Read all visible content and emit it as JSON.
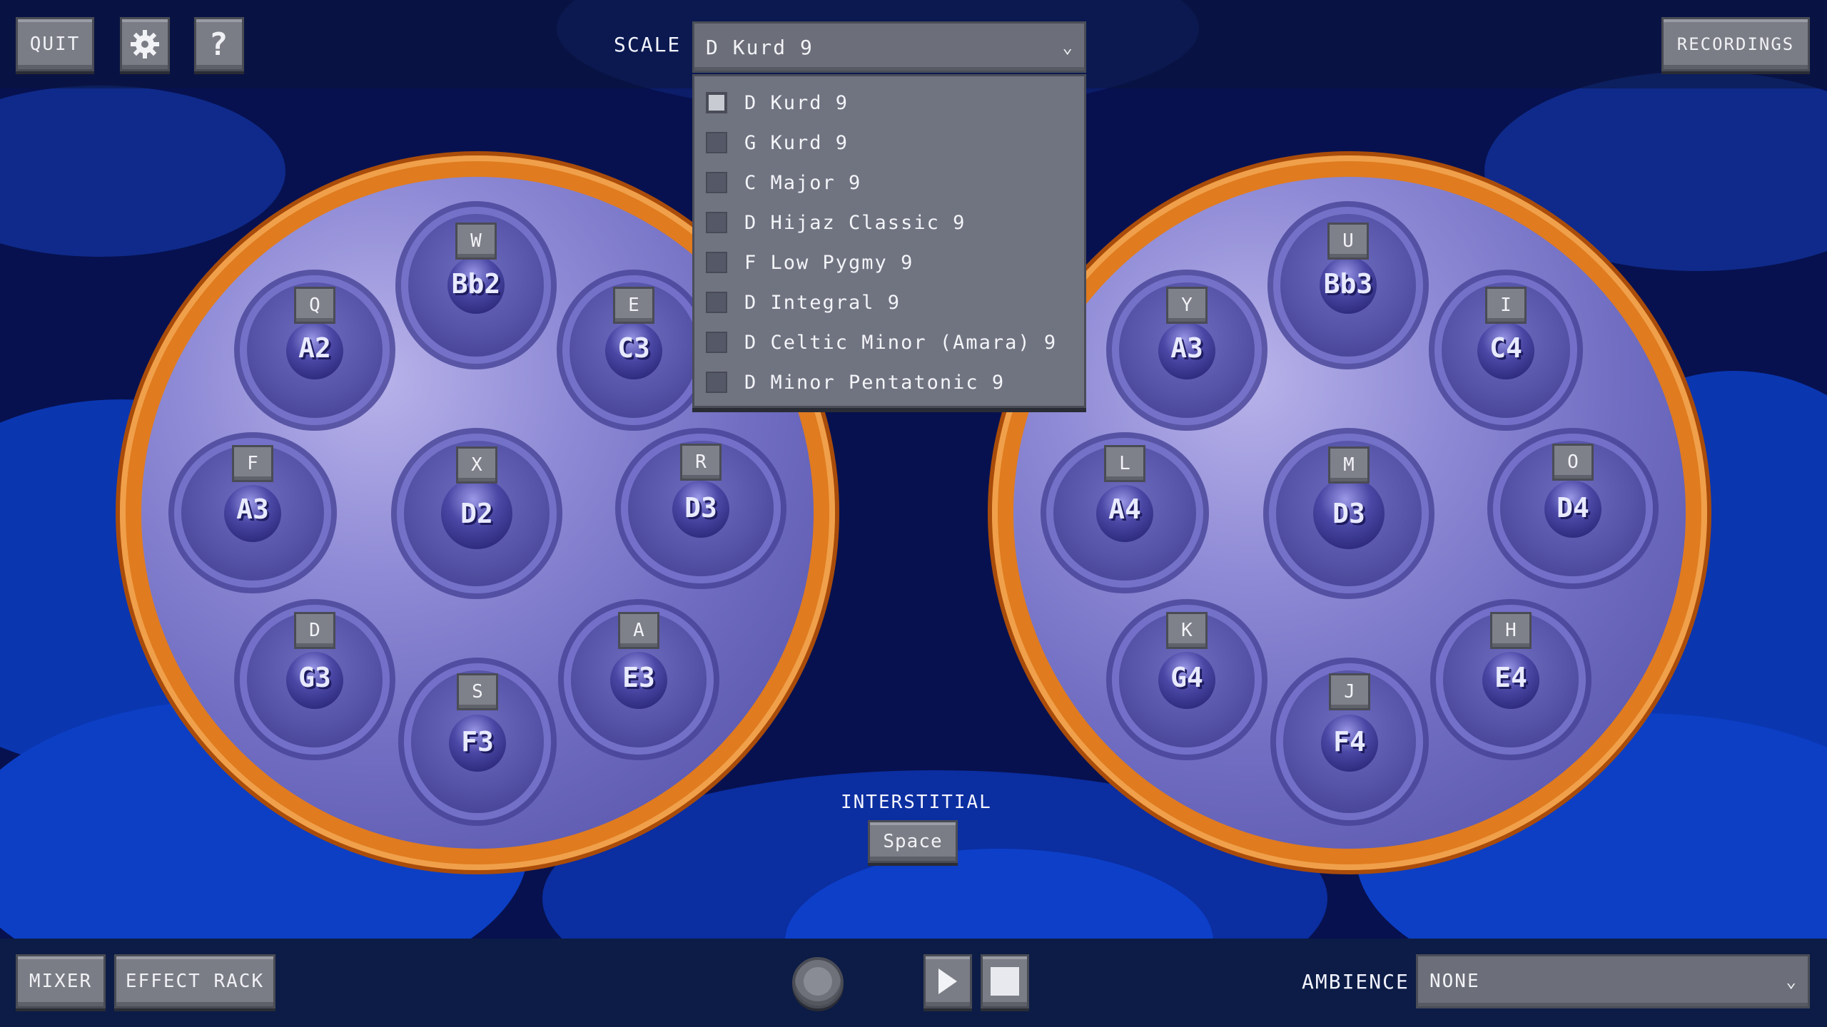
{
  "topbar": {
    "quit_label": "QUIT",
    "settings_icon": "gear-icon",
    "help_label": "?",
    "scale_label": "SCALE",
    "scale_value": "D Kurd 9",
    "recordings_label": "RECORDINGS"
  },
  "scale_dropdown": {
    "options": [
      {
        "label": "D Kurd 9",
        "checked": true
      },
      {
        "label": "G Kurd 9",
        "checked": false
      },
      {
        "label": "C Major 9",
        "checked": false
      },
      {
        "label": "D Hijaz Classic 9",
        "checked": false
      },
      {
        "label": "F Low Pygmy 9",
        "checked": false
      },
      {
        "label": "D Integral 9",
        "checked": false
      },
      {
        "label": "D Celtic Minor (Amara) 9",
        "checked": false
      },
      {
        "label": "D Minor Pentatonic 9",
        "checked": false
      }
    ]
  },
  "left_drum": {
    "tones": [
      {
        "key": "W",
        "note": "Bb2"
      },
      {
        "key": "Q",
        "note": "A2"
      },
      {
        "key": "E",
        "note": "C3"
      },
      {
        "key": "F",
        "note": "A3"
      },
      {
        "key": "X",
        "note": "D2"
      },
      {
        "key": "R",
        "note": "D3"
      },
      {
        "key": "D",
        "note": "G3"
      },
      {
        "key": "A",
        "note": "E3"
      },
      {
        "key": "S",
        "note": "F3"
      }
    ]
  },
  "right_drum": {
    "tones": [
      {
        "key": "U",
        "note": "Bb3"
      },
      {
        "key": "Y",
        "note": "A3"
      },
      {
        "key": "I",
        "note": "C4"
      },
      {
        "key": "L",
        "note": "A4"
      },
      {
        "key": "M",
        "note": "D3"
      },
      {
        "key": "O",
        "note": "D4"
      },
      {
        "key": "K",
        "note": "G4"
      },
      {
        "key": "H",
        "note": "E4"
      },
      {
        "key": "J",
        "note": "F4"
      }
    ]
  },
  "interstitial": {
    "label": "INTERSTITIAL",
    "key_label": "Space"
  },
  "bottombar": {
    "mixer_label": "MIXER",
    "effect_rack_label": "EFFECT RACK",
    "record_icon": "record-icon",
    "play_icon": "play-icon",
    "stop_icon": "stop-icon",
    "ambience_label": "AMBIENCE",
    "ambience_value": "NONE"
  },
  "colors": {
    "drum_rim": "#e07b1f",
    "drum_face": "#8f8bd6",
    "sky": "#07114f",
    "button": "#7b7d86"
  }
}
